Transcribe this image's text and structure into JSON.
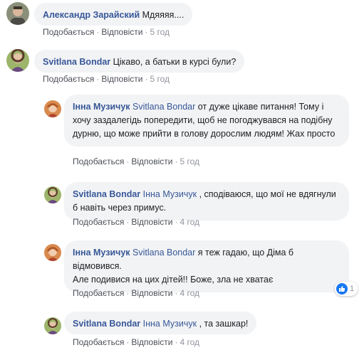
{
  "comments": [
    {
      "author": "Александр Зарайский",
      "mention": "",
      "text": "Мдяяяя....",
      "actions": {
        "like": "Подобається",
        "reply": "Відповісти",
        "time": "5 год"
      }
    },
    {
      "author": "Svitlana Bondar",
      "mention": "",
      "text": "Цікаво, а батьки в курсі були?",
      "actions": {
        "like": "Подобається",
        "reply": "Відповісти",
        "time": "5 год"
      }
    }
  ],
  "replies": [
    {
      "author": "Інна Музичук",
      "mention": "Svitlana Bondar",
      "text": "от дуже цікаве питання! Тому і хочу заздалегідь попередити, щоб не погоджувався на подібну дурню, що може прийти в голову дорослим людям! Жах просто",
      "actions": {
        "like": "Подобається",
        "reply": "Відповісти",
        "time": "5 год"
      }
    },
    {
      "author": "Svitlana Bondar",
      "mention": "Інна Музичук",
      "text": ", сподіваюся, що мої не вдягнули б навіть через примус.",
      "actions": {
        "like": "Подобається",
        "reply": "Відповісти",
        "time": "4 год"
      }
    },
    {
      "author": "Інна Музичук",
      "mention": "Svitlana Bondar",
      "text": "я теж гадаю, що Діма б відмовився.",
      "text2": "Але подивися на цих дітей!! Боже, зла не хватає",
      "reaction_count": "1",
      "actions": {
        "like": "Подобається",
        "reply": "Відповісти",
        "time": "4 год"
      }
    },
    {
      "author": "Svitlana Bondar",
      "mention": "Інна Музичук",
      "text": ", та зашкар!",
      "actions": {
        "like": "Подобається",
        "reply": "Відповісти",
        "time": "4 год"
      }
    }
  ],
  "colors": {
    "author": "#385898",
    "bubble": "#f2f3f5",
    "meta": "#90949c",
    "like": "#1877f2"
  }
}
